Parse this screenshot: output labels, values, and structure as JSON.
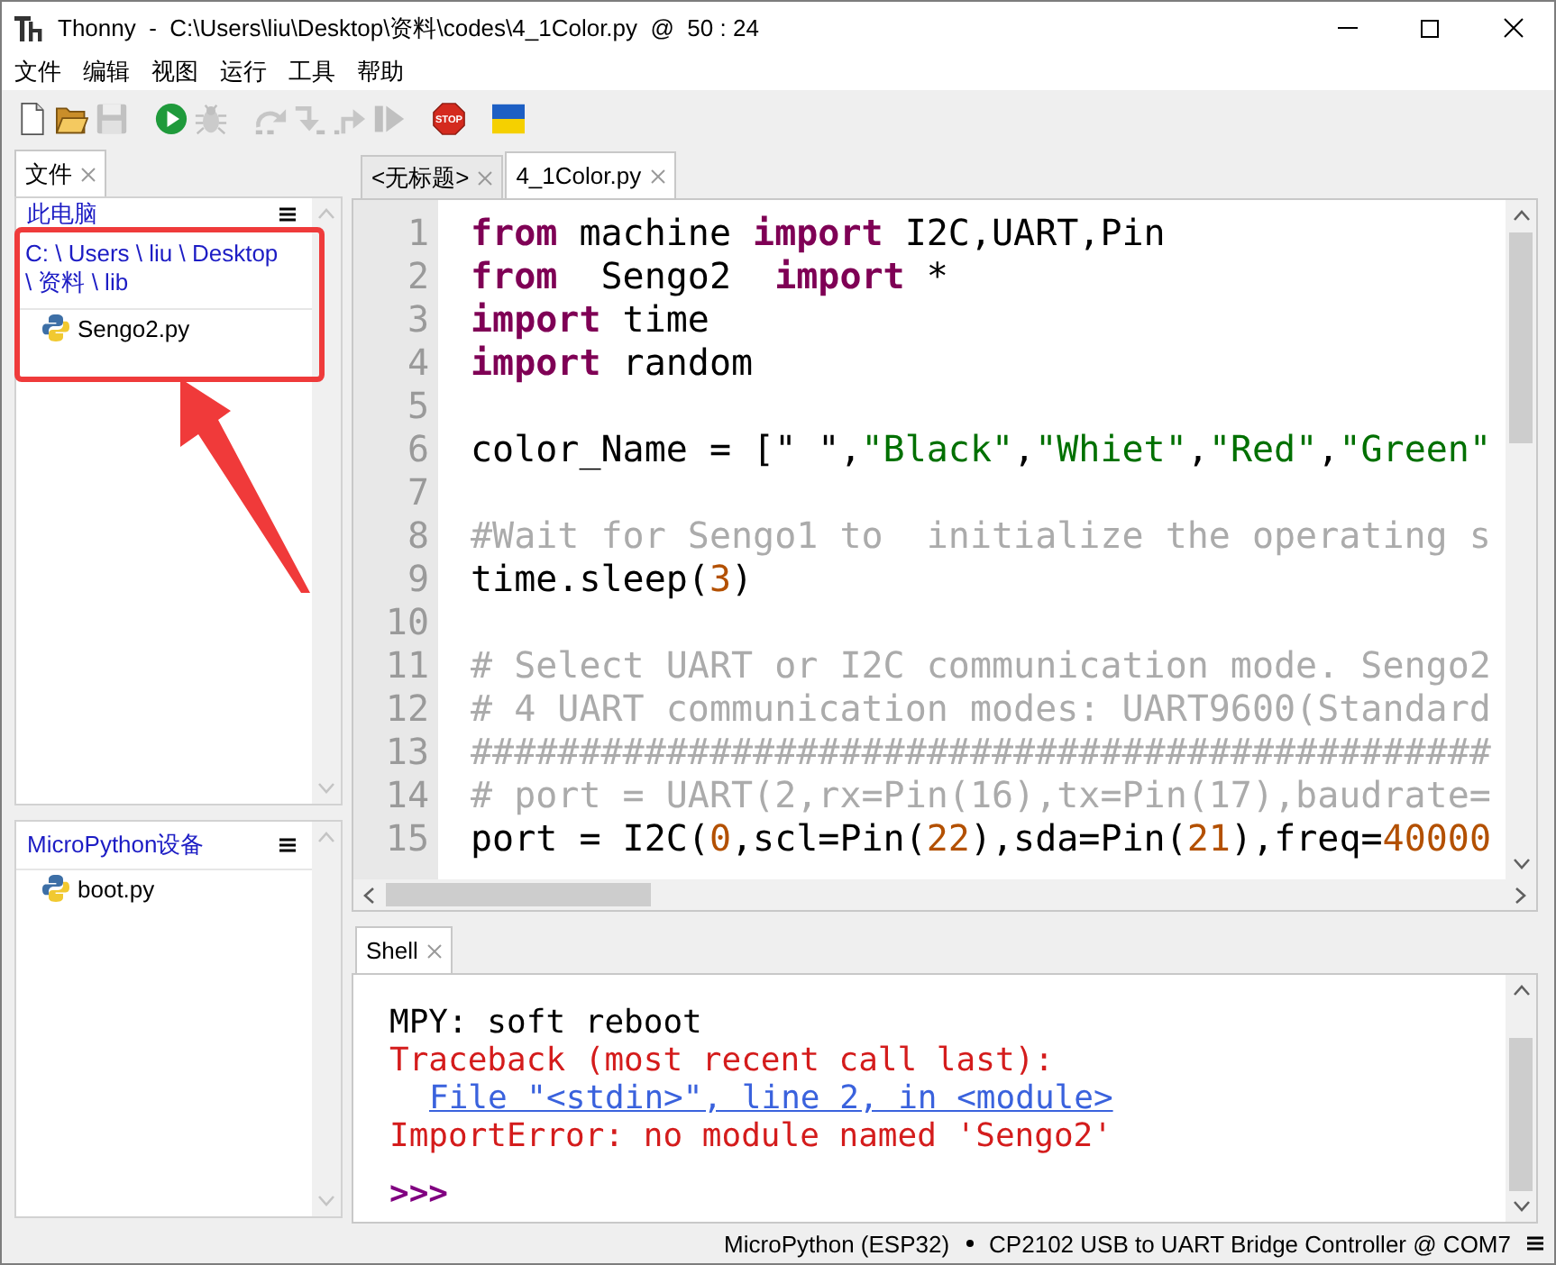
{
  "window": {
    "title": "Thonny  -  C:\\Users\\liu\\Desktop\\资料\\codes\\4_1Color.py  @  50 : 24"
  },
  "menu": [
    "文件",
    "编辑",
    "视图",
    "运行",
    "工具",
    "帮助"
  ],
  "toolbar": [
    {
      "buttons": [
        {
          "kind": "new",
          "disabled": false
        },
        {
          "kind": "open",
          "disabled": false
        },
        {
          "kind": "save",
          "disabled": true
        }
      ]
    },
    {
      "buttons": [
        {
          "kind": "run",
          "disabled": false
        },
        {
          "kind": "debug",
          "disabled": true
        }
      ]
    },
    {
      "buttons": [
        {
          "kind": "over",
          "disabled": true
        },
        {
          "kind": "into",
          "disabled": true
        },
        {
          "kind": "out",
          "disabled": true
        },
        {
          "kind": "resume",
          "disabled": true
        }
      ]
    },
    {
      "buttons": [
        {
          "kind": "stop",
          "disabled": false,
          "label": "STOP"
        }
      ]
    },
    {
      "buttons": [
        {
          "kind": "flag",
          "disabled": false
        }
      ]
    }
  ],
  "sidebar": {
    "tabs": [
      {
        "label": "文件",
        "selected": true
      }
    ],
    "panes": [
      {
        "header": "此电脑",
        "path": "C: \\ Users \\ liu \\ Desktop \\ 资料 \\ lib",
        "items": [
          {
            "name": "Sengo2.py"
          }
        ]
      },
      {
        "header": "MicroPython设备",
        "items": [
          {
            "name": "boot.py"
          }
        ]
      }
    ]
  },
  "editor": {
    "tabs": [
      {
        "label": "<无标题>",
        "selected": false
      },
      {
        "label": "4_1Color.py",
        "selected": true
      }
    ],
    "lines": [
      {
        "number": "1",
        "tokens": [
          {
            "kind": "keyword",
            "text": "from"
          },
          {
            "kind": "name",
            "text": " machine "
          },
          {
            "kind": "keyword",
            "text": "import"
          },
          {
            "kind": "name",
            "text": " I2C,UART,Pin"
          }
        ]
      },
      {
        "number": "2",
        "tokens": [
          {
            "kind": "keyword",
            "text": "from"
          },
          {
            "kind": "name",
            "text": "  Sengo2  "
          },
          {
            "kind": "keyword",
            "text": "import"
          },
          {
            "kind": "name",
            "text": " *"
          }
        ]
      },
      {
        "number": "3",
        "tokens": [
          {
            "kind": "keyword",
            "text": "import"
          },
          {
            "kind": "name",
            "text": " time"
          }
        ]
      },
      {
        "number": "4",
        "tokens": [
          {
            "kind": "keyword",
            "text": "import"
          },
          {
            "kind": "name",
            "text": " random"
          }
        ]
      },
      {
        "number": "5"
      },
      {
        "number": "6",
        "tokens": [
          {
            "kind": "name",
            "text": "color_Name = [\" \","
          },
          {
            "kind": "string",
            "text": "\"Black\""
          },
          {
            "kind": "name",
            "text": ","
          },
          {
            "kind": "string",
            "text": "\"Whiet\""
          },
          {
            "kind": "name",
            "text": ","
          },
          {
            "kind": "string",
            "text": "\"Red\""
          },
          {
            "kind": "name",
            "text": ","
          },
          {
            "kind": "string",
            "text": "\"Green\""
          }
        ]
      },
      {
        "number": "7"
      },
      {
        "number": "8",
        "tokens": [
          {
            "kind": "comment",
            "text": "#Wait for Sengo1 to  initialize the operating s"
          }
        ]
      },
      {
        "number": "9",
        "tokens": [
          {
            "kind": "name",
            "text": "time.sleep("
          },
          {
            "kind": "number",
            "text": "3"
          },
          {
            "kind": "name",
            "text": ")"
          }
        ]
      },
      {
        "number": "10"
      },
      {
        "number": "11",
        "tokens": [
          {
            "kind": "comment",
            "text": "# Select UART or I2C communication mode. Sengo2"
          }
        ]
      },
      {
        "number": "12",
        "tokens": [
          {
            "kind": "comment",
            "text": "# 4 UART communication modes: UART9600(Standard"
          }
        ]
      },
      {
        "number": "13",
        "tokens": [
          {
            "kind": "comment",
            "text": "###############################################"
          }
        ]
      },
      {
        "number": "14",
        "tokens": [
          {
            "kind": "comment",
            "text": "# port = UART(2,rx=Pin(16),tx=Pin(17),baudrate="
          }
        ]
      },
      {
        "number": "15",
        "tokens": [
          {
            "kind": "name",
            "text": "port = I2C("
          },
          {
            "kind": "number",
            "text": "0"
          },
          {
            "kind": "name",
            "text": ",scl=Pin("
          },
          {
            "kind": "number",
            "text": "22"
          },
          {
            "kind": "name",
            "text": "),sda=Pin("
          },
          {
            "kind": "number",
            "text": "21"
          },
          {
            "kind": "name",
            "text": "),freq="
          },
          {
            "kind": "number",
            "text": "40000"
          }
        ]
      }
    ]
  },
  "shell": {
    "tabs": [
      {
        "label": "Shell",
        "selected": true
      }
    ],
    "lines": [
      {
        "kind": "output",
        "text": "MPY: soft reboot"
      },
      {
        "kind": "error",
        "text": "Traceback (most recent call last):"
      },
      {
        "kind": "link",
        "text": "File \"<stdin>\", line 2, in <module>"
      },
      {
        "kind": "error",
        "text": "ImportError: no module named 'Sengo2'"
      },
      {
        "kind": "prompt",
        "text": ">>>"
      }
    ]
  },
  "status_bar": {
    "interpreter": "MicroPython (ESP32)",
    "port": "CP2102 USB to UART Bridge Controller @ COM7"
  },
  "annotation": {
    "highlight_box": true,
    "arrow": true
  }
}
